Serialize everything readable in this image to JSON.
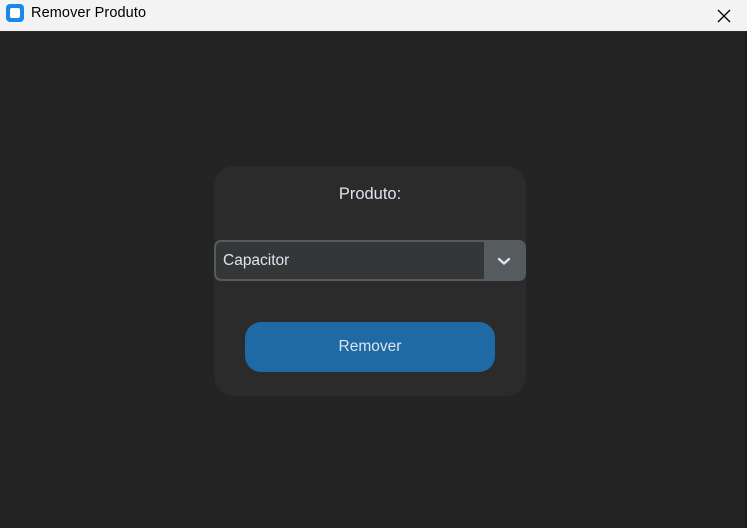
{
  "window": {
    "title": "Remover Produto",
    "icon": "app-window-icon",
    "close_icon": "close-icon"
  },
  "form": {
    "label": "Produto:",
    "product_select": {
      "value": "Capacitor",
      "icon": "chevron-down-icon"
    },
    "remove_button_label": "Remover"
  },
  "colors": {
    "background": "#242424",
    "card": "#2b2b2b",
    "combo_bg": "#343638",
    "combo_border": "#565b5e",
    "button": "#1f6aa5",
    "text": "#dce4ee"
  }
}
